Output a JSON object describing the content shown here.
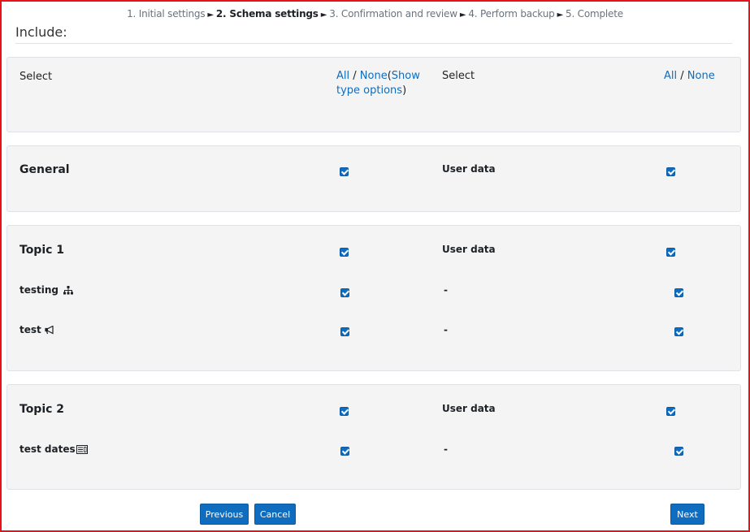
{
  "steps": [
    {
      "label": "1. Initial settings",
      "current": false
    },
    {
      "label": "2. Schema settings",
      "current": true
    },
    {
      "label": "3. Confirmation and review",
      "current": false
    },
    {
      "label": "4. Perform backup",
      "current": false
    },
    {
      "label": "5. Complete",
      "current": false
    }
  ],
  "step_separator": "►",
  "include_label": "Include:",
  "select_panel": {
    "select_label_left": "Select",
    "select_label_right": "Select",
    "all_label": "All",
    "none_label": "None",
    "slash": "/",
    "show_type_options_label": "Show type options",
    "paren_open": "(",
    "paren_close": ")"
  },
  "general": {
    "title": "General",
    "user_data_label": "User data",
    "included": true,
    "userdata": true
  },
  "topic1": {
    "title": "Topic 1",
    "user_data_label": "User data",
    "included": true,
    "userdata": true,
    "activities": [
      {
        "name": "testing",
        "icon": "hierarchy-icon",
        "userdata_label": "-",
        "included": true,
        "userdata": true
      },
      {
        "name": "test",
        "icon": "megaphone-icon",
        "userdata_label": "-",
        "included": true,
        "userdata": true
      }
    ]
  },
  "topic2": {
    "title": "Topic 2",
    "user_data_label": "User data",
    "included": true,
    "userdata": true,
    "activities": [
      {
        "name": "test dates",
        "icon": "calendar-icon",
        "userdata_label": "-",
        "included": true,
        "userdata": true
      }
    ]
  },
  "buttons": {
    "previous": "Previous",
    "cancel": "Cancel",
    "next": "Next"
  },
  "colors": {
    "accent": "#0f6cbf",
    "frame": "#e8121b",
    "panel_bg": "#f4f4f4"
  }
}
